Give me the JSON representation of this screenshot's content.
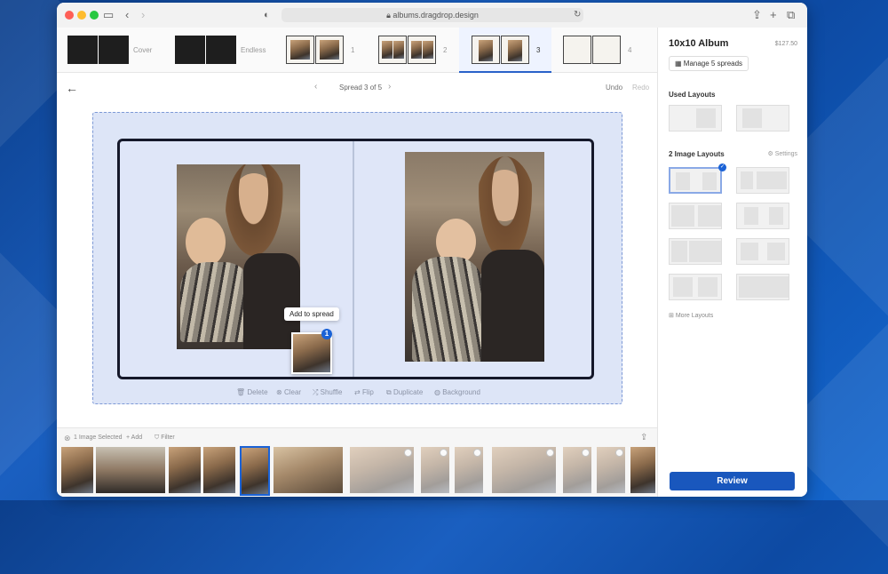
{
  "browser": {
    "url": "albums.dragdrop.design"
  },
  "spreads_strip": {
    "items": [
      {
        "label": "Cover"
      },
      {
        "label": "Endless"
      },
      {
        "label": "1"
      },
      {
        "label": "2"
      },
      {
        "label": "3"
      },
      {
        "label": "4"
      }
    ]
  },
  "nav": {
    "spread_label": "Spread 3 of 5",
    "undo": "Undo",
    "redo": "Redo"
  },
  "tooltip": {
    "text": "Add to spread",
    "badge": "1"
  },
  "spread_actions": [
    "Delete",
    "Clear",
    "Shuffle",
    "Flip",
    "Duplicate",
    "Background"
  ],
  "library": {
    "selected": "1 Image Selected",
    "add": "Add",
    "filter": "Filter"
  },
  "sidebar": {
    "title": "10x10 Album",
    "price": "$127.50",
    "manage_button": "Manage 5 spreads",
    "used_layouts": "Used Layouts",
    "two_image_layouts": "2 Image Layouts",
    "settings": "Settings",
    "more_layouts": "More Layouts",
    "review_button": "Review"
  },
  "colors": {
    "accent": "#1957bd",
    "canvas": "#dde5f7"
  }
}
